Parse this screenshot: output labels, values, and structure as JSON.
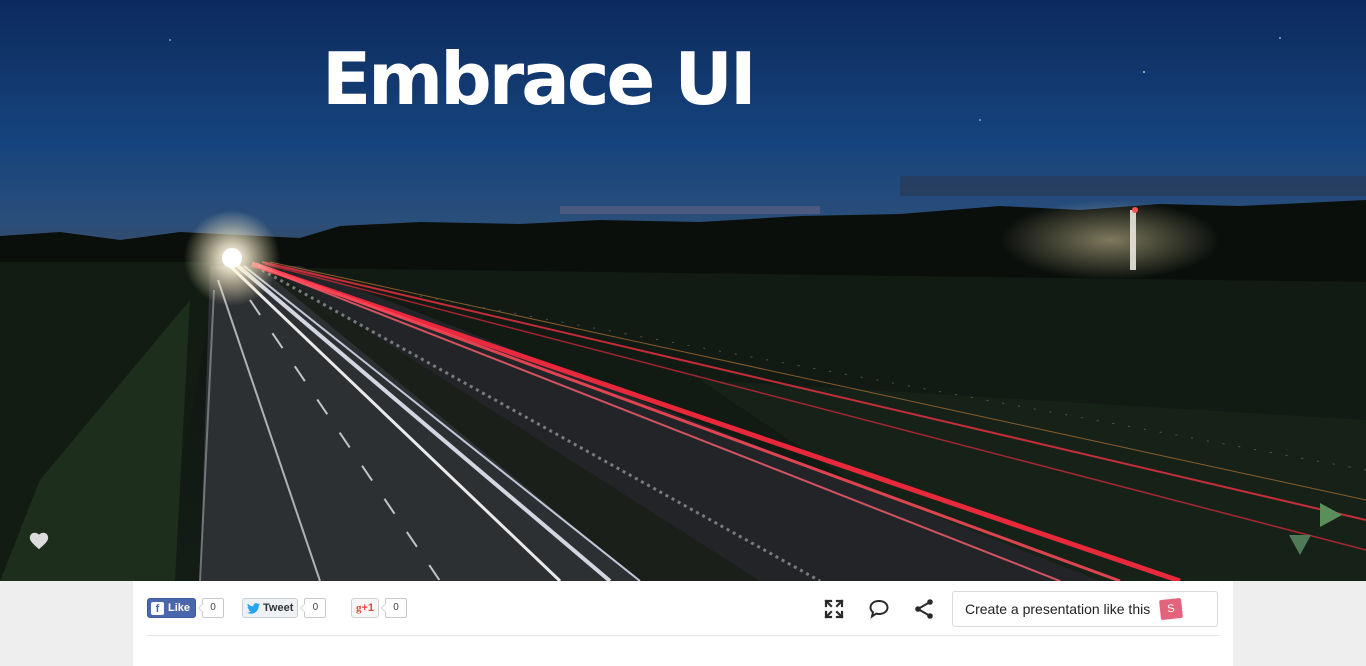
{
  "slide": {
    "title": "Embrace UI"
  },
  "icons": {
    "like": "heart-icon",
    "next": "play-right-icon",
    "down": "arrow-down-icon",
    "fullscreen": "fullscreen-icon",
    "comment": "comment-icon",
    "share": "share-icon"
  },
  "social": {
    "facebook": {
      "label": "Like",
      "count": "0"
    },
    "twitter": {
      "label": "Tweet",
      "count": "0"
    },
    "googleplus": {
      "label": "+1",
      "count": "0"
    }
  },
  "cta": {
    "label": "Create a presentation like this",
    "logo": "S"
  },
  "colors": {
    "nav_arrow": "#5a8f5c",
    "cta_logo": "#e4637c",
    "facebook": "#4a67ad",
    "googleplus": "#dd4b39"
  }
}
